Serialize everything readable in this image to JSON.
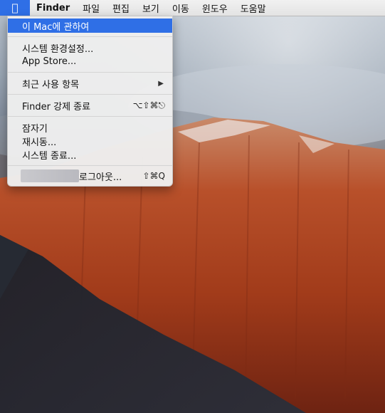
{
  "menubar": {
    "apple_icon": "apple-logo-icon",
    "app_name": "Finder",
    "items": [
      "파일",
      "편집",
      "보기",
      "이동",
      "윈도우",
      "도움말"
    ]
  },
  "apple_menu": {
    "about": "이 Mac에 관하여",
    "system_prefs": "시스템 환경설정...",
    "app_store": "App Store...",
    "recent_items": "최근 사용 항목",
    "force_quit": "Finder 강제 종료",
    "force_quit_shortcut": "⌥⇧⌘⎋",
    "sleep": "잠자기",
    "restart": "재시동...",
    "shutdown": "시스템 종료...",
    "logout_suffix": "로그아웃...",
    "logout_shortcut": "⇧⌘Q"
  },
  "colors": {
    "selection": "#2f6fe6"
  }
}
